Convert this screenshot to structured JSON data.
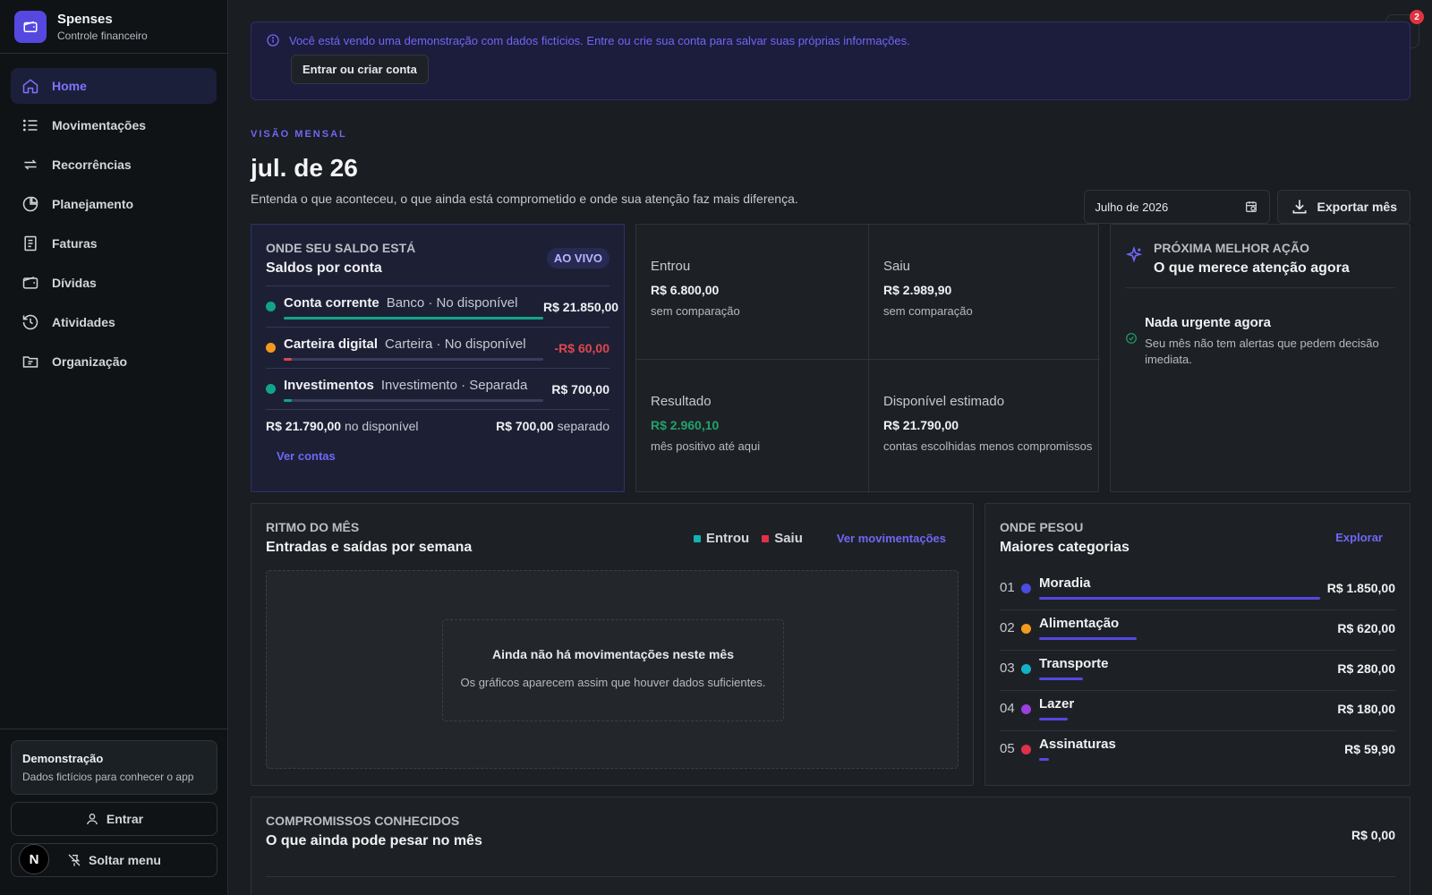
{
  "brand": {
    "name": "Spenses",
    "subtitle": "Controle financeiro"
  },
  "nav": [
    {
      "label": "Home",
      "icon": "home-icon",
      "active": true
    },
    {
      "label": "Movimentações",
      "icon": "list-icon"
    },
    {
      "label": "Recorrências",
      "icon": "repeat-icon"
    },
    {
      "label": "Planejamento",
      "icon": "pie-chart-icon"
    },
    {
      "label": "Faturas",
      "icon": "receipt-icon"
    },
    {
      "label": "Dívidas",
      "icon": "wallet-icon"
    },
    {
      "label": "Atividades",
      "icon": "history-icon"
    },
    {
      "label": "Organização",
      "icon": "folder-icon"
    }
  ],
  "sidebar_footer": {
    "demo_title": "Demonstração",
    "demo_sub": "Dados fictícios para conhecer o app",
    "login_label": "Entrar",
    "unpin_label": "Soltar menu",
    "badge_letter": "N"
  },
  "banner": {
    "text": "Você está vendo uma demonstração com dados fictícios. Entre ou crie sua conta para salvar suas próprias informações.",
    "button": "Entrar ou criar conta"
  },
  "notifications": {
    "count": "2"
  },
  "header": {
    "eyebrow": "VISÃO MENSAL",
    "title": "jul. de 26",
    "description": "Entenda o que aconteceu, o que ainda está comprometido e onde sua atenção faz mais diferença.",
    "month_value": "Julho de 2026",
    "export_label": "Exportar mês"
  },
  "saldo": {
    "eyebrow": "ONDE SEU SALDO ESTÁ",
    "title": "Saldos por conta",
    "live_badge": "AO VIVO",
    "accounts": [
      {
        "name": "Conta corrente",
        "meta": "Banco · No disponível",
        "value": "R$ 21.850,00",
        "color": "#12a48a",
        "share": 1.0,
        "negative": false
      },
      {
        "name": "Carteira digital",
        "meta": "Carteira · No disponível",
        "value": "-R$ 60,00",
        "color": "#f39a1e",
        "share": 0.03,
        "negative": true
      },
      {
        "name": "Investimentos",
        "meta": "Investimento · Separada",
        "value": "R$ 700,00",
        "color": "#12a48a",
        "share": 0.03,
        "negative": false
      }
    ],
    "available_value": "R$ 21.790,00",
    "available_label": "no disponível",
    "separated_value": "R$ 700,00",
    "separated_label": "separado",
    "link": "Ver contas"
  },
  "stats": {
    "in": {
      "label": "Entrou",
      "value": "R$ 6.800,00",
      "sub": "sem comparação"
    },
    "out": {
      "label": "Saiu",
      "value": "R$ 2.989,90",
      "sub": "sem comparação"
    },
    "result": {
      "label": "Resultado",
      "value": "R$ 2.960,10",
      "sub": "mês positivo até aqui"
    },
    "available": {
      "label": "Disponível estimado",
      "value": "R$ 21.790,00",
      "sub": "contas escolhidas menos compromissos"
    }
  },
  "action": {
    "eyebrow": "PRÓXIMA MELHOR AÇÃO",
    "title": "O que merece atenção agora",
    "item_title": "Nada urgente agora",
    "item_sub": "Seu mês não tem alertas que pedem decisão imediata."
  },
  "ritmo": {
    "eyebrow": "RITMO DO MÊS",
    "title": "Entradas e saídas por semana",
    "legend_in": "Entrou",
    "legend_out": "Saiu",
    "link": "Ver movimentações",
    "empty_title": "Ainda não há movimentações neste mês",
    "empty_sub": "Os gráficos aparecem assim que houver dados suficientes.",
    "color_in": "#12b3b3",
    "color_out": "#e0304a"
  },
  "pesou": {
    "eyebrow": "ONDE PESOU",
    "title": "Maiores categorias",
    "link": "Explorar",
    "categories": [
      {
        "idx": "01",
        "name": "Moradia",
        "value": "R$ 1.850,00",
        "color": "#4a4be0",
        "share": 1.0
      },
      {
        "idx": "02",
        "name": "Alimentação",
        "value": "R$ 620,00",
        "color": "#f39a1e",
        "share": 0.335
      },
      {
        "idx": "03",
        "name": "Transporte",
        "value": "R$ 280,00",
        "color": "#12b3c9",
        "share": 0.151
      },
      {
        "idx": "04",
        "name": "Lazer",
        "value": "R$ 180,00",
        "color": "#9b3fe0",
        "share": 0.097
      },
      {
        "idx": "05",
        "name": "Assinaturas",
        "value": "R$ 59,90",
        "color": "#e0304a",
        "share": 0.032
      }
    ]
  },
  "compromissos": {
    "eyebrow": "COMPROMISSOS CONHECIDOS",
    "title": "O que ainda pode pesar no mês",
    "value": "R$ 0,00"
  }
}
